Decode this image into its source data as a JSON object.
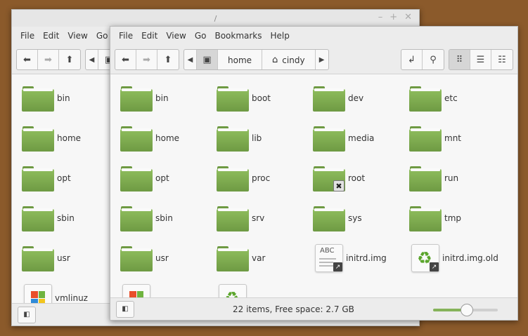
{
  "back_window": {
    "title": "/",
    "controls": [
      "–",
      "+",
      "✕"
    ],
    "menu": [
      "File",
      "Edit",
      "View",
      "Go"
    ],
    "items": [
      {
        "label": "bin",
        "icon": "folder"
      },
      {
        "label": "home",
        "icon": "folder"
      },
      {
        "label": "opt",
        "icon": "folder"
      },
      {
        "label": "sbin",
        "icon": "folder"
      },
      {
        "label": "usr",
        "icon": "folder"
      },
      {
        "label": "vmlinuz",
        "icon": "windows-executable"
      }
    ]
  },
  "front_window": {
    "menu": [
      "File",
      "Edit",
      "View",
      "Go",
      "Bookmarks",
      "Help"
    ],
    "breadcrumb": [
      "home",
      "cindy"
    ],
    "items": [
      {
        "label": "bin",
        "icon": "folder"
      },
      {
        "label": "boot",
        "icon": "folder"
      },
      {
        "label": "dev",
        "icon": "folder"
      },
      {
        "label": "etc",
        "icon": "folder"
      },
      {
        "label": "home",
        "icon": "folder"
      },
      {
        "label": "lib",
        "icon": "folder"
      },
      {
        "label": "media",
        "icon": "folder"
      },
      {
        "label": "mnt",
        "icon": "folder"
      },
      {
        "label": "opt",
        "icon": "folder"
      },
      {
        "label": "proc",
        "icon": "folder"
      },
      {
        "label": "root",
        "icon": "folder-no-access"
      },
      {
        "label": "run",
        "icon": "folder"
      },
      {
        "label": "sbin",
        "icon": "folder"
      },
      {
        "label": "srv",
        "icon": "folder"
      },
      {
        "label": "sys",
        "icon": "folder"
      },
      {
        "label": "tmp",
        "icon": "folder"
      },
      {
        "label": "usr",
        "icon": "folder"
      },
      {
        "label": "var",
        "icon": "folder"
      },
      {
        "label": "initrd.img",
        "icon": "text-file-link"
      },
      {
        "label": "initrd.img.old",
        "icon": "recycle-file-link"
      }
    ],
    "status": "22 items, Free space: 2.7 GB",
    "zoom_level": 0.52,
    "colors": {
      "folder": "#7aa64b",
      "accent": "#85b35a"
    }
  }
}
